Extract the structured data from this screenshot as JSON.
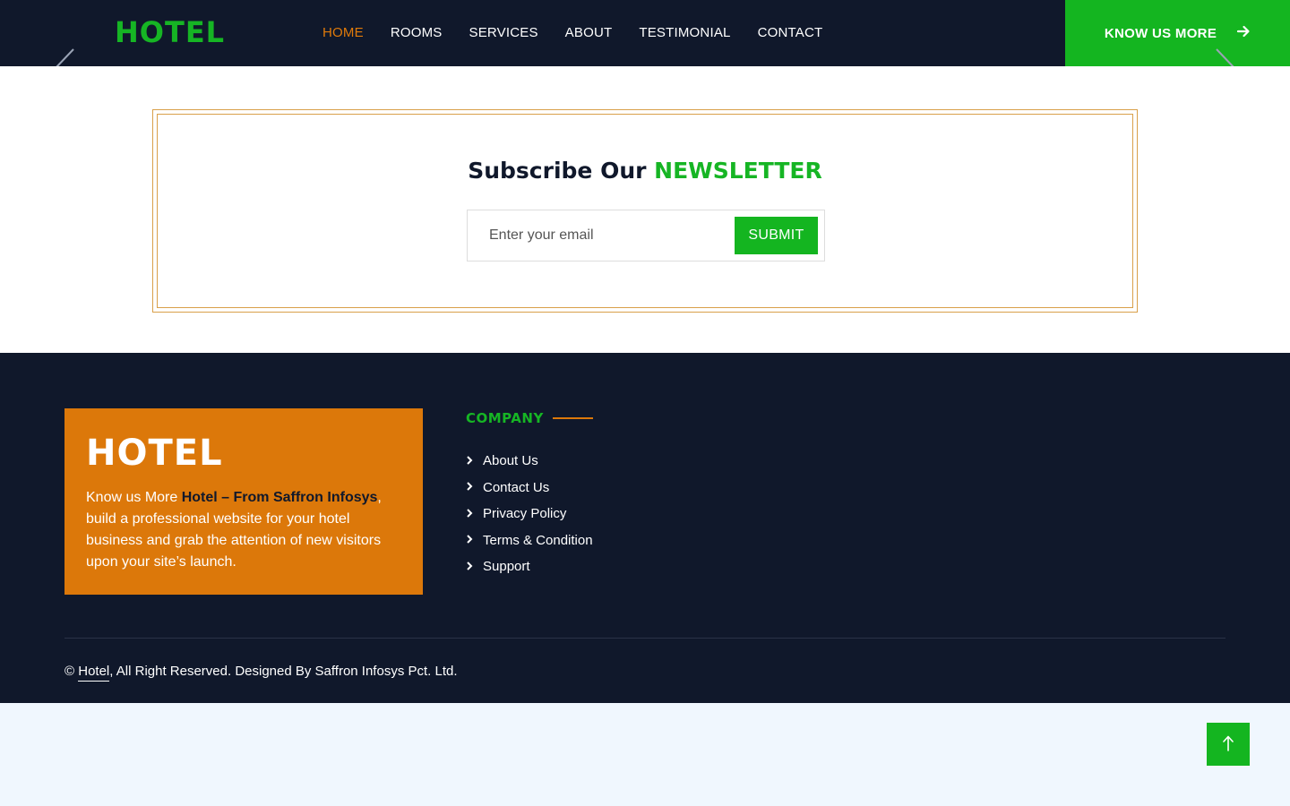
{
  "navbar": {
    "brand": "HOTEL",
    "links": [
      {
        "label": "HOME",
        "active": true
      },
      {
        "label": "ROOMS"
      },
      {
        "label": "SERVICES"
      },
      {
        "label": "ABOUT"
      },
      {
        "label": "TESTIMONIAL"
      },
      {
        "label": "CONTACT"
      }
    ],
    "cta_label": "KNOW US MORE",
    "cta_icon": "arrow-right-icon"
  },
  "newsletter": {
    "title_prefix": "Subscribe Our ",
    "title_accent": "NEWSLETTER",
    "email_placeholder": "Enter your email",
    "email_value": "",
    "submit_label": "SUBMIT"
  },
  "footer": {
    "about": {
      "brand": "HOTEL",
      "text_prefix": "Know us More ",
      "text_strong": "Hotel – From Saffron Infosys",
      "text_suffix": ", build a professional website for your hotel business and grab the attention of new visitors upon your site’s launch."
    },
    "company": {
      "heading": "COMPANY",
      "links": [
        "About Us",
        "Contact Us",
        "Privacy Policy",
        "Terms & Condition",
        "Support"
      ]
    },
    "copyright": {
      "symbol": "©",
      "link_text": "Hotel",
      "suffix": ", All Right Reserved. Designed By Saffron Infosys Pct. Ltd."
    }
  },
  "colors": {
    "navy": "#10182b",
    "green": "#14b520",
    "orange": "#dc780a",
    "gold_border": "#d9a04a",
    "page_bg": "#f0f7fe"
  },
  "icons": {
    "slider_prev": "chevron-left-icon",
    "slider_next": "chevron-right-icon",
    "list_bullet": "chevron-right-icon",
    "back_to_top": "arrow-up-icon"
  }
}
